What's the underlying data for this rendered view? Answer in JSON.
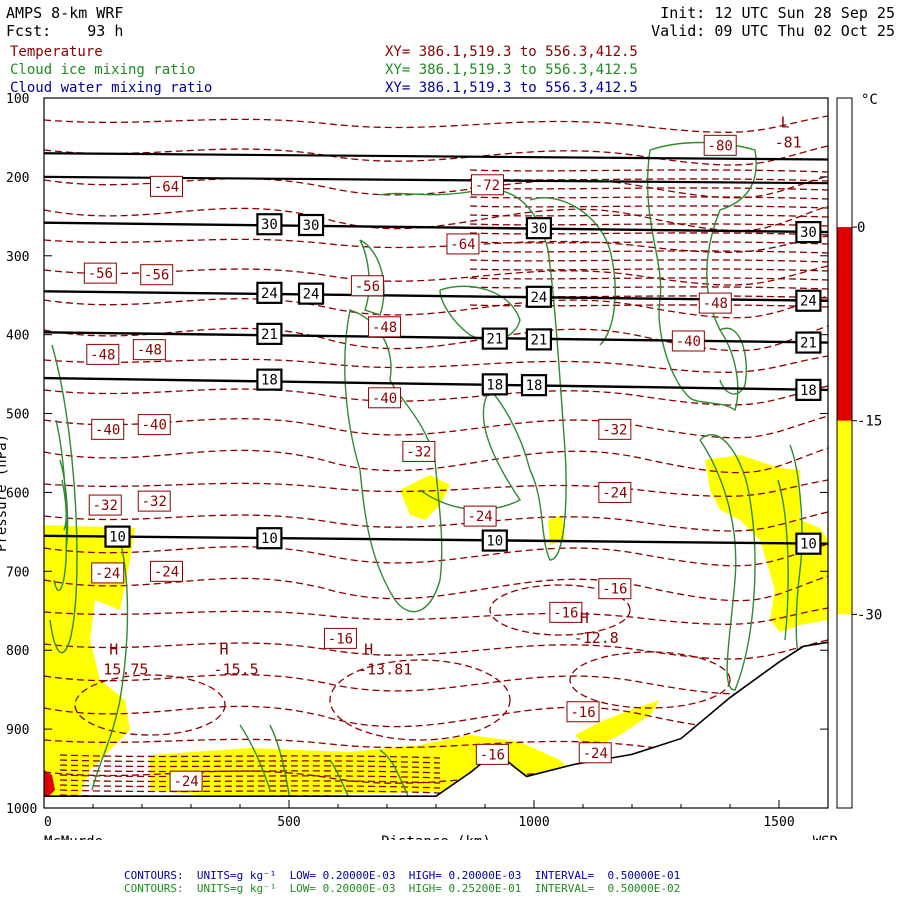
{
  "header": {
    "model": "AMPS 8-km WRF",
    "forecast": "Fcst:    93 h",
    "init": "Init: 12 UTC Sun 28 Sep 25",
    "valid": "Valid: 09 UTC Thu 02 Oct 25"
  },
  "fields": [
    {
      "name": "Temperature",
      "xy": "XY= 386.1,519.3 to 556.3,412.5",
      "color": "#8b0000"
    },
    {
      "name": "Cloud ice mixing ratio",
      "xy": "XY= 386.1,519.3 to 556.3,412.5",
      "color": "#1e8c1e"
    },
    {
      "name": "Cloud water mixing ratio",
      "xy": "XY= 386.1,519.3 to 556.3,412.5",
      "color": "#0000a0"
    }
  ],
  "footer": [
    {
      "text": "CONTOURS:  UNITS=g kg⁻¹  LOW= 0.20000E-03  HIGH= 0.20000E-03  INTERVAL=  0.50000E-01",
      "color": "#0000a0"
    },
    {
      "text": "CONTOURS:  UNITS=g kg⁻¹  LOW= 0.20000E-03  HIGH= 0.25200E-01  INTERVAL=  0.50000E-02",
      "color": "#1e8c1e"
    }
  ],
  "chart_data": {
    "type": "heatmap",
    "xlabel": "Distance (km)",
    "ylabel": "Pressure (hPa)",
    "xlim": [
      0,
      1600
    ],
    "ylim": [
      1000,
      100
    ],
    "x_ticks": [
      0,
      500,
      1000,
      1500
    ],
    "y_ticks": [
      100,
      200,
      300,
      400,
      500,
      600,
      700,
      800,
      900,
      1000
    ],
    "endpoints": {
      "left": "McMurdo",
      "right": "WSD"
    },
    "colorbar": {
      "unit": "°C",
      "ticks": [
        0,
        -15,
        -30
      ],
      "bands": [
        {
          "from": 0,
          "to": 10,
          "color": "#ffffff"
        },
        {
          "from": -15,
          "to": 0,
          "color": "#e00000"
        },
        {
          "from": -30,
          "to": -15,
          "color": "#ffff00"
        },
        {
          "from": -45,
          "to": -30,
          "color": "#ffffff"
        }
      ]
    },
    "theta_lines": [
      {
        "label": "30",
        "left_p": 258,
        "right_p": 270,
        "label_positions": [
          [
            460,
            260
          ],
          [
            545,
            261
          ],
          [
            1010,
            265
          ],
          [
            1560,
            270
          ]
        ]
      },
      {
        "label": "24",
        "left_p": 345,
        "right_p": 357,
        "label_positions": [
          [
            460,
            347
          ],
          [
            545,
            348
          ],
          [
            1010,
            352
          ],
          [
            1560,
            357
          ]
        ]
      },
      {
        "label": "21",
        "left_p": 397,
        "right_p": 410,
        "label_positions": [
          [
            460,
            399
          ],
          [
            920,
            405
          ],
          [
            1010,
            406
          ],
          [
            1560,
            410
          ]
        ]
      },
      {
        "label": "18",
        "left_p": 455,
        "right_p": 470,
        "label_positions": [
          [
            460,
            457
          ],
          [
            920,
            463
          ],
          [
            1000,
            464
          ],
          [
            1560,
            470
          ]
        ]
      },
      {
        "label": "10",
        "left_p": 655,
        "right_p": 665,
        "label_positions": [
          [
            150,
            656
          ],
          [
            460,
            658
          ],
          [
            920,
            661
          ],
          [
            1560,
            665
          ]
        ]
      }
    ],
    "other_black_lines_p": [
      170,
      200
    ],
    "temperature_labels": [
      {
        "text": "-64",
        "x": 250,
        "p": 212
      },
      {
        "text": "-80",
        "x": 1380,
        "p": 160
      },
      {
        "text": "-72",
        "x": 905,
        "p": 210
      },
      {
        "text": "-64",
        "x": 855,
        "p": 285
      },
      {
        "text": "-56",
        "x": 115,
        "p": 322
      },
      {
        "text": "-56",
        "x": 230,
        "p": 324
      },
      {
        "text": "-56",
        "x": 660,
        "p": 338
      },
      {
        "text": "-48",
        "x": 695,
        "p": 390
      },
      {
        "text": "-48",
        "x": 120,
        "p": 425
      },
      {
        "text": "-48",
        "x": 215,
        "p": 419
      },
      {
        "text": "-48",
        "x": 1370,
        "p": 360
      },
      {
        "text": "-40",
        "x": 130,
        "p": 520
      },
      {
        "text": "-40",
        "x": 225,
        "p": 514
      },
      {
        "text": "-40",
        "x": 695,
        "p": 480
      },
      {
        "text": "-40",
        "x": 1315,
        "p": 408
      },
      {
        "text": "-32",
        "x": 765,
        "p": 548
      },
      {
        "text": "-32",
        "x": 1165,
        "p": 520
      },
      {
        "text": "-32",
        "x": 125,
        "p": 616
      },
      {
        "text": "-32",
        "x": 225,
        "p": 611
      },
      {
        "text": "-24",
        "x": 890,
        "p": 630
      },
      {
        "text": "-24",
        "x": 1165,
        "p": 600
      },
      {
        "text": "-24",
        "x": 130,
        "p": 702
      },
      {
        "text": "-24",
        "x": 250,
        "p": 700
      },
      {
        "text": "-16",
        "x": 1165,
        "p": 722
      },
      {
        "text": "-16",
        "x": 1065,
        "p": 752
      },
      {
        "text": "-16",
        "x": 605,
        "p": 785
      },
      {
        "text": "-16",
        "x": 1100,
        "p": 878
      },
      {
        "text": "-16",
        "x": 915,
        "p": 932
      },
      {
        "text": "-24",
        "x": 1125,
        "p": 930
      },
      {
        "text": "-24",
        "x": 290,
        "p": 966
      }
    ],
    "extrema": [
      {
        "kind": "H",
        "value": "15.75",
        "x": 170,
        "p": 818
      },
      {
        "kind": "H",
        "value": "-15.5",
        "x": 395,
        "p": 818
      },
      {
        "kind": "H",
        "value": "-13.81",
        "x": 690,
        "p": 818
      },
      {
        "kind": "H",
        "value": "-12.8",
        "x": 1130,
        "p": 778
      },
      {
        "kind": "L",
        "value": "-81",
        "x": 1540,
        "p": 150
      }
    ],
    "terrain_surface": [
      [
        0,
        985
      ],
      [
        600,
        985
      ],
      [
        800,
        985
      ],
      [
        870,
        955
      ],
      [
        900,
        940
      ],
      [
        935,
        935
      ],
      [
        960,
        948
      ],
      [
        985,
        960
      ],
      [
        1010,
        956
      ],
      [
        1080,
        945
      ],
      [
        1200,
        932
      ],
      [
        1300,
        912
      ],
      [
        1400,
        860
      ],
      [
        1500,
        815
      ],
      [
        1550,
        795
      ],
      [
        1600,
        790
      ]
    ]
  }
}
